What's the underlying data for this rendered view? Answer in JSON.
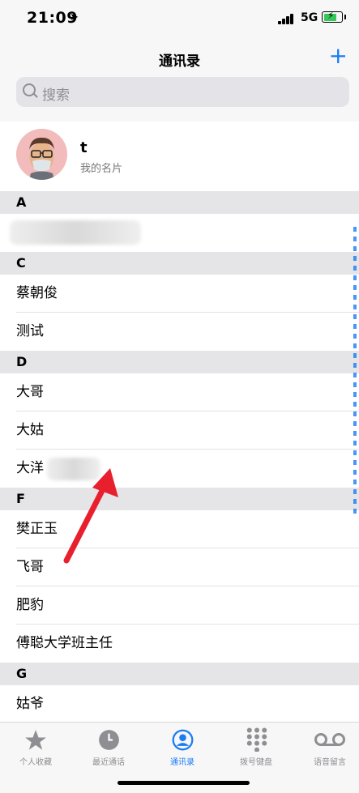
{
  "status": {
    "time": "21:09",
    "network": "5G"
  },
  "nav": {
    "title": "通讯录",
    "add_label": "+"
  },
  "search": {
    "placeholder": "搜索"
  },
  "my_card": {
    "name": "t",
    "subtitle": "我的名片"
  },
  "sections": [
    {
      "letter": "A",
      "contacts": [
        {
          "name": ""
        }
      ]
    },
    {
      "letter": "C",
      "contacts": [
        {
          "name": "蔡朝俊"
        },
        {
          "name": "测试"
        }
      ]
    },
    {
      "letter": "D",
      "contacts": [
        {
          "name": "大哥"
        },
        {
          "name": "大姑"
        },
        {
          "name": "大洋"
        }
      ]
    },
    {
      "letter": "F",
      "contacts": [
        {
          "name": "樊正玉"
        },
        {
          "name": "飞哥"
        },
        {
          "name": "肥豹"
        },
        {
          "name": "傅聪大学班主任"
        }
      ]
    },
    {
      "letter": "G",
      "contacts": [
        {
          "name": "姑爷"
        }
      ]
    }
  ],
  "tabs": [
    {
      "label": "个人收藏",
      "icon": "star-icon"
    },
    {
      "label": "最近通话",
      "icon": "clock-icon"
    },
    {
      "label": "通讯录",
      "icon": "person-circle-icon",
      "active": true
    },
    {
      "label": "拨号键盘",
      "icon": "keypad-icon"
    },
    {
      "label": "语音留言",
      "icon": "voicemail-icon"
    }
  ],
  "colors": {
    "accent": "#1a7cf4",
    "annotation_arrow": "#e8202e"
  }
}
